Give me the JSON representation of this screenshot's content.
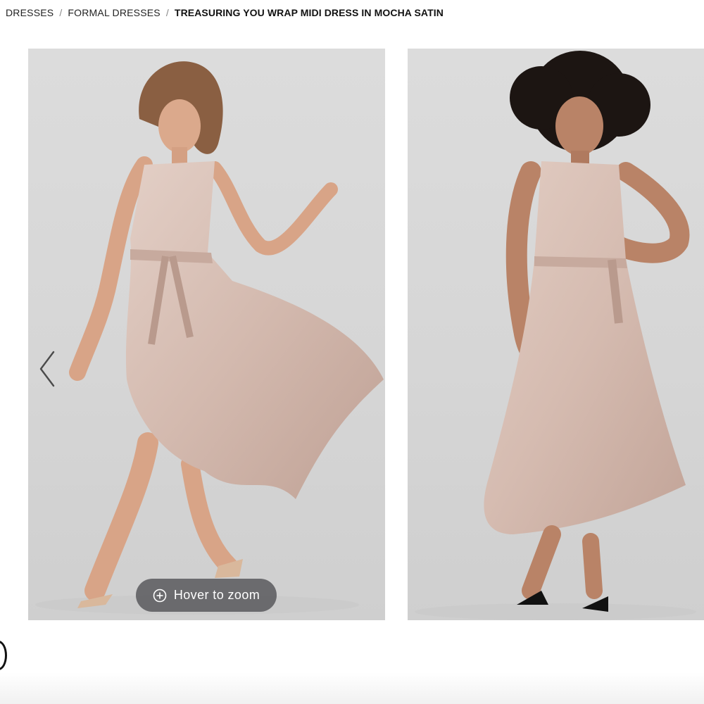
{
  "breadcrumb": {
    "items": [
      {
        "label": "DRESSES"
      },
      {
        "label": "FORMAL DRESSES"
      }
    ],
    "separator": "/",
    "current": "TREASURING YOU WRAP MIDI DRESS IN MOCHA SATIN"
  },
  "gallery": {
    "images": [
      {
        "alt": "Model twirling in mocha satin wrap midi dress"
      },
      {
        "alt": "Model standing in mocha satin wrap midi dress"
      }
    ],
    "prev_icon": "chevron-left-icon",
    "zoom_label": "Hover to zoom",
    "zoom_icon": "plus-circle-icon"
  },
  "colors": {
    "dress": "#d7bfb5",
    "backdrop": "#d8d8d8",
    "skin_1": "#d9a68a",
    "skin_2": "#b98367"
  }
}
